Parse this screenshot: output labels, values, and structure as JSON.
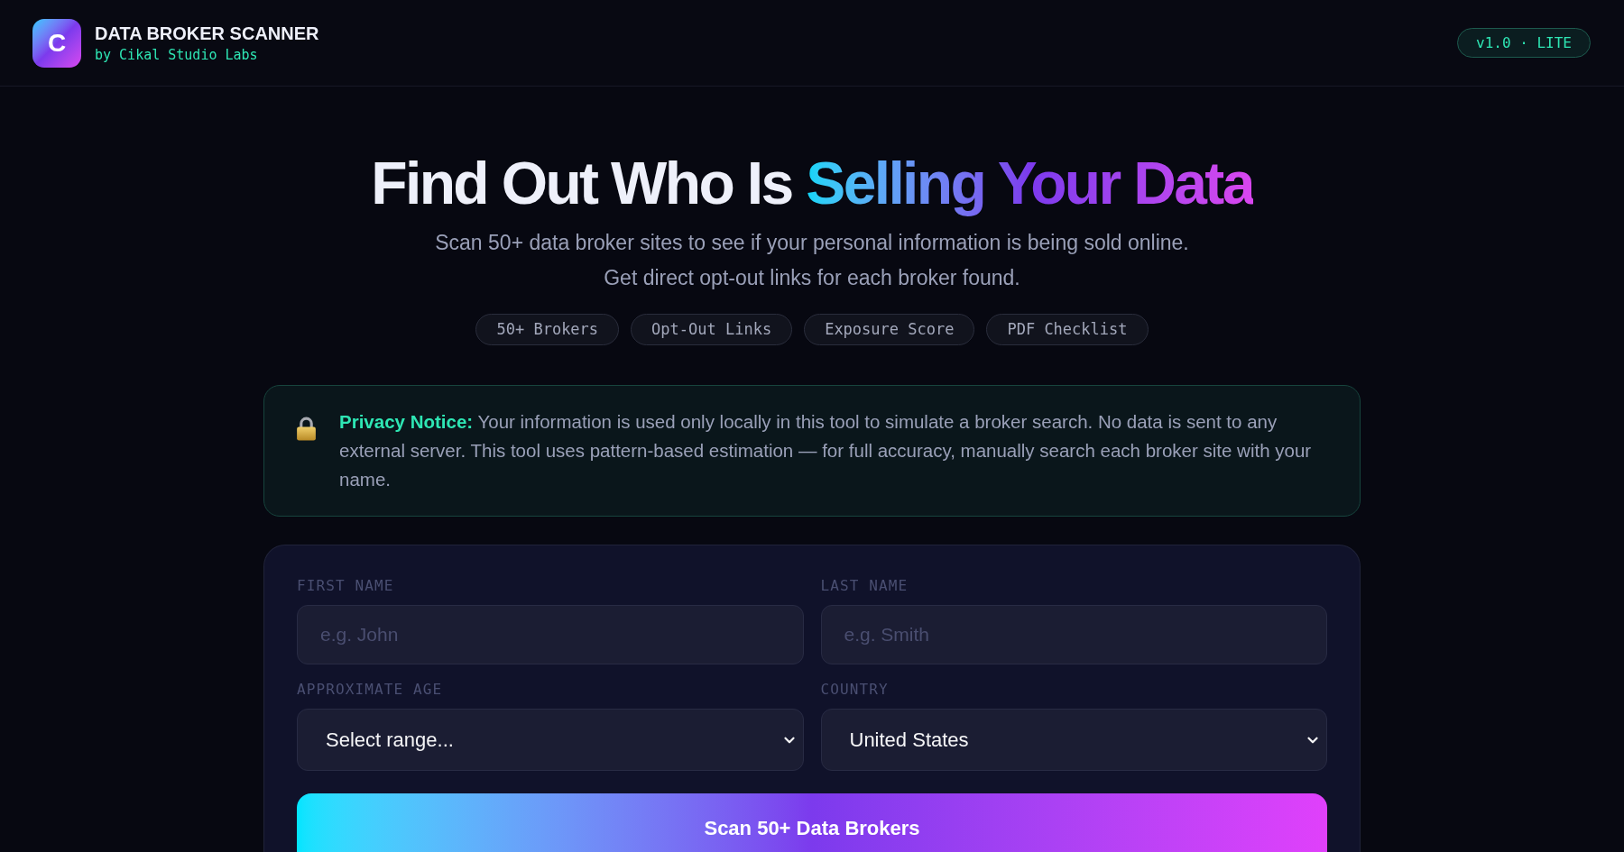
{
  "header": {
    "logo": "C",
    "title": "DATA BROKER SCANNER",
    "subtitle": "by Cikal Studio Labs",
    "badge": "v1.0 · LITE"
  },
  "hero": {
    "title": "Find Out Who Is",
    "title_highlight": "Selling Your Data",
    "subtitle": [
      "Scan 50+ data broker sites to see if your personal information is being sold online.",
      "Get direct opt-out links for each broker found."
    ],
    "tags": [
      "50+ Brokers",
      "Opt-Out Links",
      "Exposure Score",
      "PDF Checklist"
    ]
  },
  "privacy_notice": {
    "text": "**Privacy Notice:** Your information is used only locally in this tool to simulate a broker search. No data is sent to any external server. This tool uses pattern-based estimation — for full accuracy, manually search each broker site with your name."
  },
  "form": {
    "fields": [
      {
        "kind": "text",
        "label": "FIRST NAME",
        "placeholder": "e.g. John"
      },
      {
        "kind": "text",
        "label": "LAST NAME",
        "placeholder": "e.g. Smith"
      },
      {
        "kind": "select",
        "label": "APPROXIMATE AGE",
        "value": "Select range..."
      },
      {
        "kind": "select",
        "label": "COUNTRY",
        "value": "United States"
      }
    ],
    "submit": "Scan 50+ Data Brokers"
  }
}
